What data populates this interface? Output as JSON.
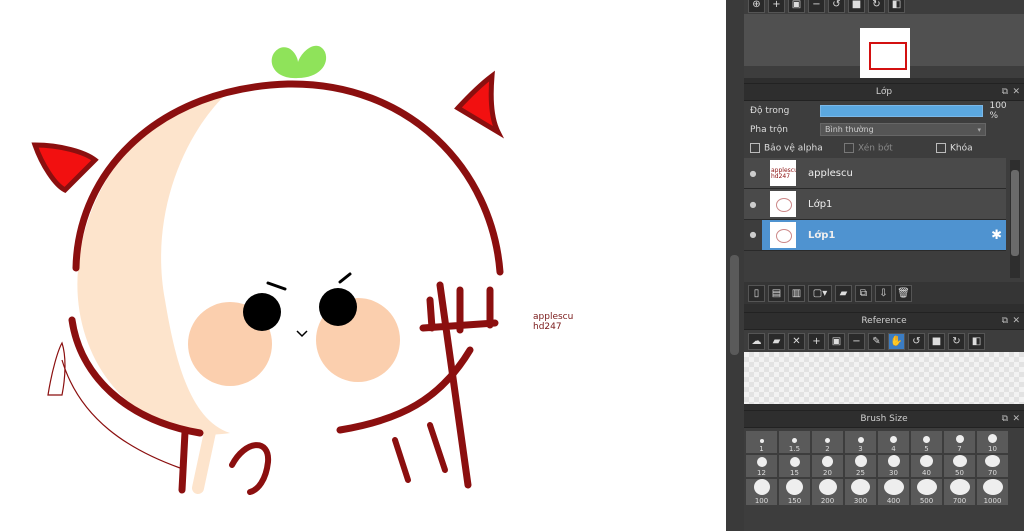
{
  "canvas": {
    "signature_line1": "applescu",
    "signature_line2": "hd247"
  },
  "navigator": {
    "icons": [
      "zoom-fit-icon",
      "zoom-in-icon",
      "fit-window-icon",
      "zoom-out-icon",
      "rotate-left-icon",
      "fullscreen-icon",
      "rotate-right-icon",
      "flip-icon"
    ]
  },
  "layers_panel": {
    "title": "Lớp",
    "opacity_label": "Độ trong",
    "opacity_value": "100 %",
    "opacity_fraction": 1.0,
    "blend_label": "Pha trộn",
    "blend_value": "Bình thường",
    "protect_alpha_label": "Bảo vệ alpha",
    "clipping_label": "Xén bớt",
    "lock_label": "Khóa",
    "layers": [
      {
        "name": "applescu",
        "thumb_text": "applescu hd247",
        "selected": false
      },
      {
        "name": "Lớp1",
        "thumb_text": "",
        "selected": false
      },
      {
        "name": "Lớp1",
        "thumb_text": "",
        "selected": true
      }
    ]
  },
  "reference_panel": {
    "title": "Reference"
  },
  "brush_panel": {
    "title": "Brush Size",
    "sizes": [
      "1",
      "1.5",
      "2",
      "3",
      "4",
      "5",
      "7",
      "10",
      "12",
      "15",
      "20",
      "25",
      "30",
      "40",
      "50",
      "70",
      "100",
      "150",
      "200",
      "300",
      "400",
      "500",
      "700",
      "1000"
    ]
  },
  "colors": {
    "outline": "#8b0f0f",
    "face_shade": "#fde4cc",
    "blush": "#fbcfae",
    "horn": "#f21010",
    "leaf": "#8fe35a",
    "selection": "#4f93d0"
  }
}
